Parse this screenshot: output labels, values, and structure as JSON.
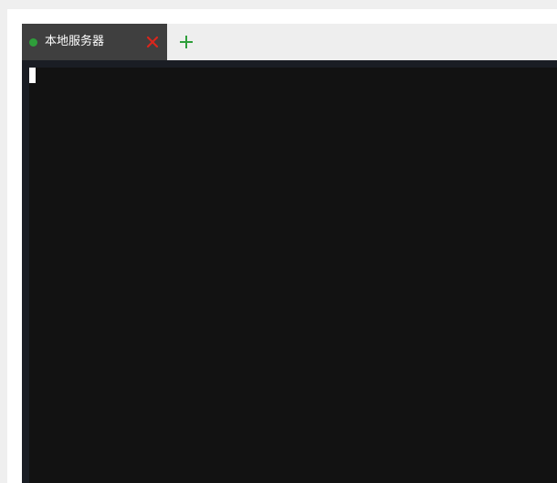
{
  "tabs": [
    {
      "label": "本地服务器",
      "status": "connected",
      "status_color": "#2e9e3a",
      "icon": "status-dot-icon",
      "close_icon": "close-icon",
      "close_color": "#d9261c"
    }
  ],
  "add_tab": {
    "icon": "plus-icon",
    "color": "#2e9e3a"
  },
  "terminal": {
    "content": "",
    "background": "#121212",
    "cursor_color": "#ffffff"
  }
}
